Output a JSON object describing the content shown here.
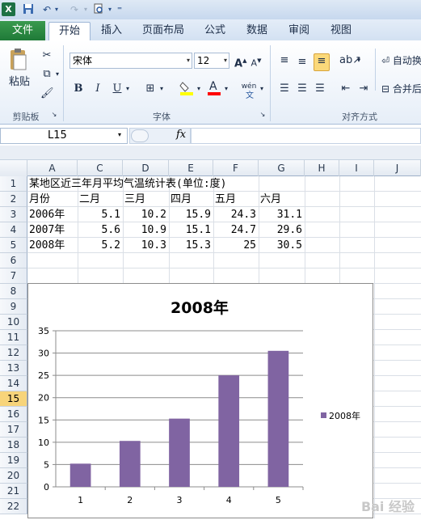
{
  "window": {
    "logo": "X",
    "quick_access": [
      "save-icon",
      "undo-icon",
      "redo-icon",
      "print-preview-icon",
      "customize-icon"
    ]
  },
  "menu": {
    "file": "文件",
    "tabs": [
      "开始",
      "插入",
      "页面布局",
      "公式",
      "数据",
      "审阅",
      "视图"
    ]
  },
  "ribbon": {
    "clipboard": {
      "paste": "粘贴",
      "label": "剪贴板"
    },
    "font": {
      "name": "宋体",
      "size": "12",
      "label": "字体",
      "bold": "B",
      "italic": "I",
      "underline": "U",
      "wen": "wén"
    },
    "alignment": {
      "label": "对齐方式",
      "wrap": "自动换",
      "merge": "合并后"
    }
  },
  "formula_bar": {
    "name_box": "L15",
    "fx": "fx",
    "formula": ""
  },
  "sheet": {
    "columns": [
      "A",
      "C",
      "D",
      "E",
      "F",
      "G",
      "H",
      "I",
      "J"
    ],
    "rows": [
      "1",
      "2",
      "3",
      "4",
      "5",
      "6",
      "7",
      "8",
      "9",
      "10",
      "11",
      "12",
      "13",
      "14",
      "15",
      "16",
      "17",
      "18",
      "19",
      "20",
      "21",
      "22"
    ],
    "selected_row": "15",
    "title": "某地区近三年月平均气温统计表(单位:度)",
    "header": [
      "月份",
      "二月",
      "三月",
      "四月",
      "五月",
      "六月"
    ],
    "data": [
      [
        "2006年",
        "5.1",
        "10.2",
        "15.9",
        "24.3",
        "31.1"
      ],
      [
        "2007年",
        "5.6",
        "10.9",
        "15.1",
        "24.7",
        "29.6"
      ],
      [
        "2008年",
        "5.2",
        "10.3",
        "15.3",
        "25",
        "30.5"
      ]
    ]
  },
  "chart_data": {
    "type": "bar",
    "title": "2008年",
    "categories": [
      "1",
      "2",
      "3",
      "4",
      "5"
    ],
    "series": [
      {
        "name": "2008年",
        "values": [
          5.2,
          10.3,
          15.3,
          25,
          30.5
        ],
        "color": "#8064a2"
      }
    ],
    "yticks": [
      "0",
      "5",
      "10",
      "15",
      "20",
      "25",
      "30",
      "35"
    ],
    "ylim": [
      0,
      35
    ],
    "grid": true,
    "legend": "right"
  },
  "watermark": "Bai 经验"
}
